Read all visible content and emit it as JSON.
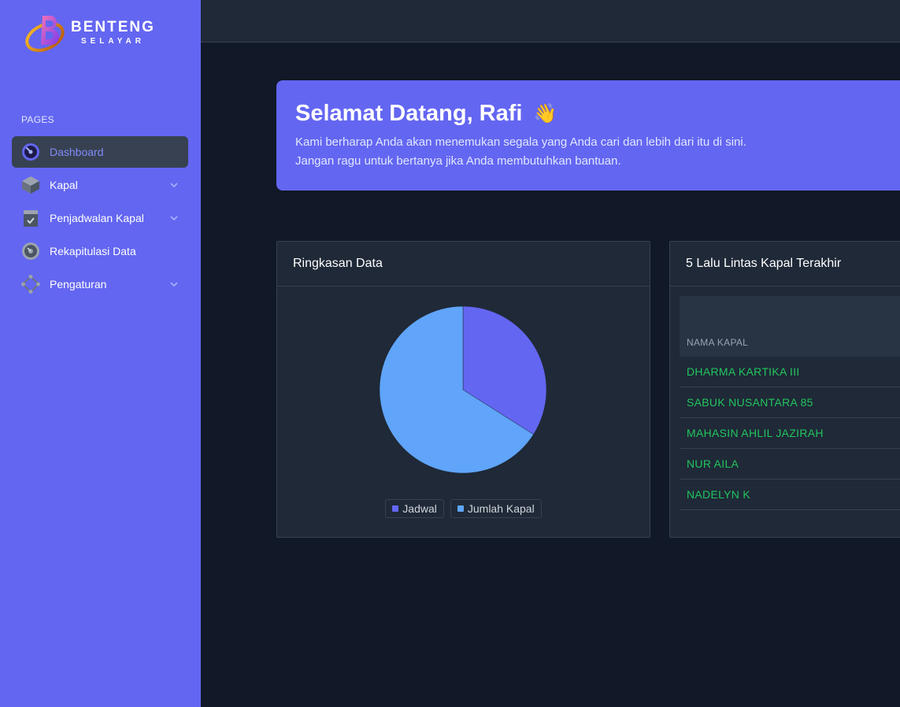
{
  "brand": {
    "title": "BENTENG",
    "subtitle": "SELAYAR",
    "accent": "#6366f1"
  },
  "sidebar": {
    "section": "PAGES",
    "items": [
      {
        "label": "Dashboard",
        "icon": "dashboard-gauge-icon",
        "active": true,
        "expandable": false
      },
      {
        "label": "Kapal",
        "icon": "cube-icon",
        "active": false,
        "expandable": true
      },
      {
        "label": "Penjadwalan Kapal",
        "icon": "clipboard-check-icon",
        "active": false,
        "expandable": true
      },
      {
        "label": "Rekapitulasi Data",
        "icon": "disc-icon",
        "active": false,
        "expandable": false
      },
      {
        "label": "Pengaturan",
        "icon": "network-nodes-icon",
        "active": false,
        "expandable": true
      }
    ]
  },
  "welcome": {
    "title": "Selamat Datang, Rafi",
    "emoji": "👋",
    "line1": "Kami berharap Anda akan menemukan segala yang Anda cari dan lebih dari itu di sini.",
    "line2": "Jangan ragu untuk bertanya jika Anda membutuhkan bantuan."
  },
  "summary_card": {
    "title": "Ringkasan Data"
  },
  "chart_data": {
    "type": "pie",
    "categories": [
      "Jadwal",
      "Jumlah Kapal"
    ],
    "values": [
      34,
      66
    ],
    "colors": [
      "#6366f1",
      "#60a5fa"
    ],
    "legend_position": "bottom"
  },
  "traffic_card": {
    "title": "5 Lalu Lintas Kapal Terakhir",
    "column": "NAMA KAPAL",
    "rows": [
      "DHARMA KARTIKA III",
      "SABUK NUSANTARA 85",
      "MAHASIN AHLIL JAZIRAH",
      "NUR AILA",
      "NADELYN K"
    ]
  }
}
